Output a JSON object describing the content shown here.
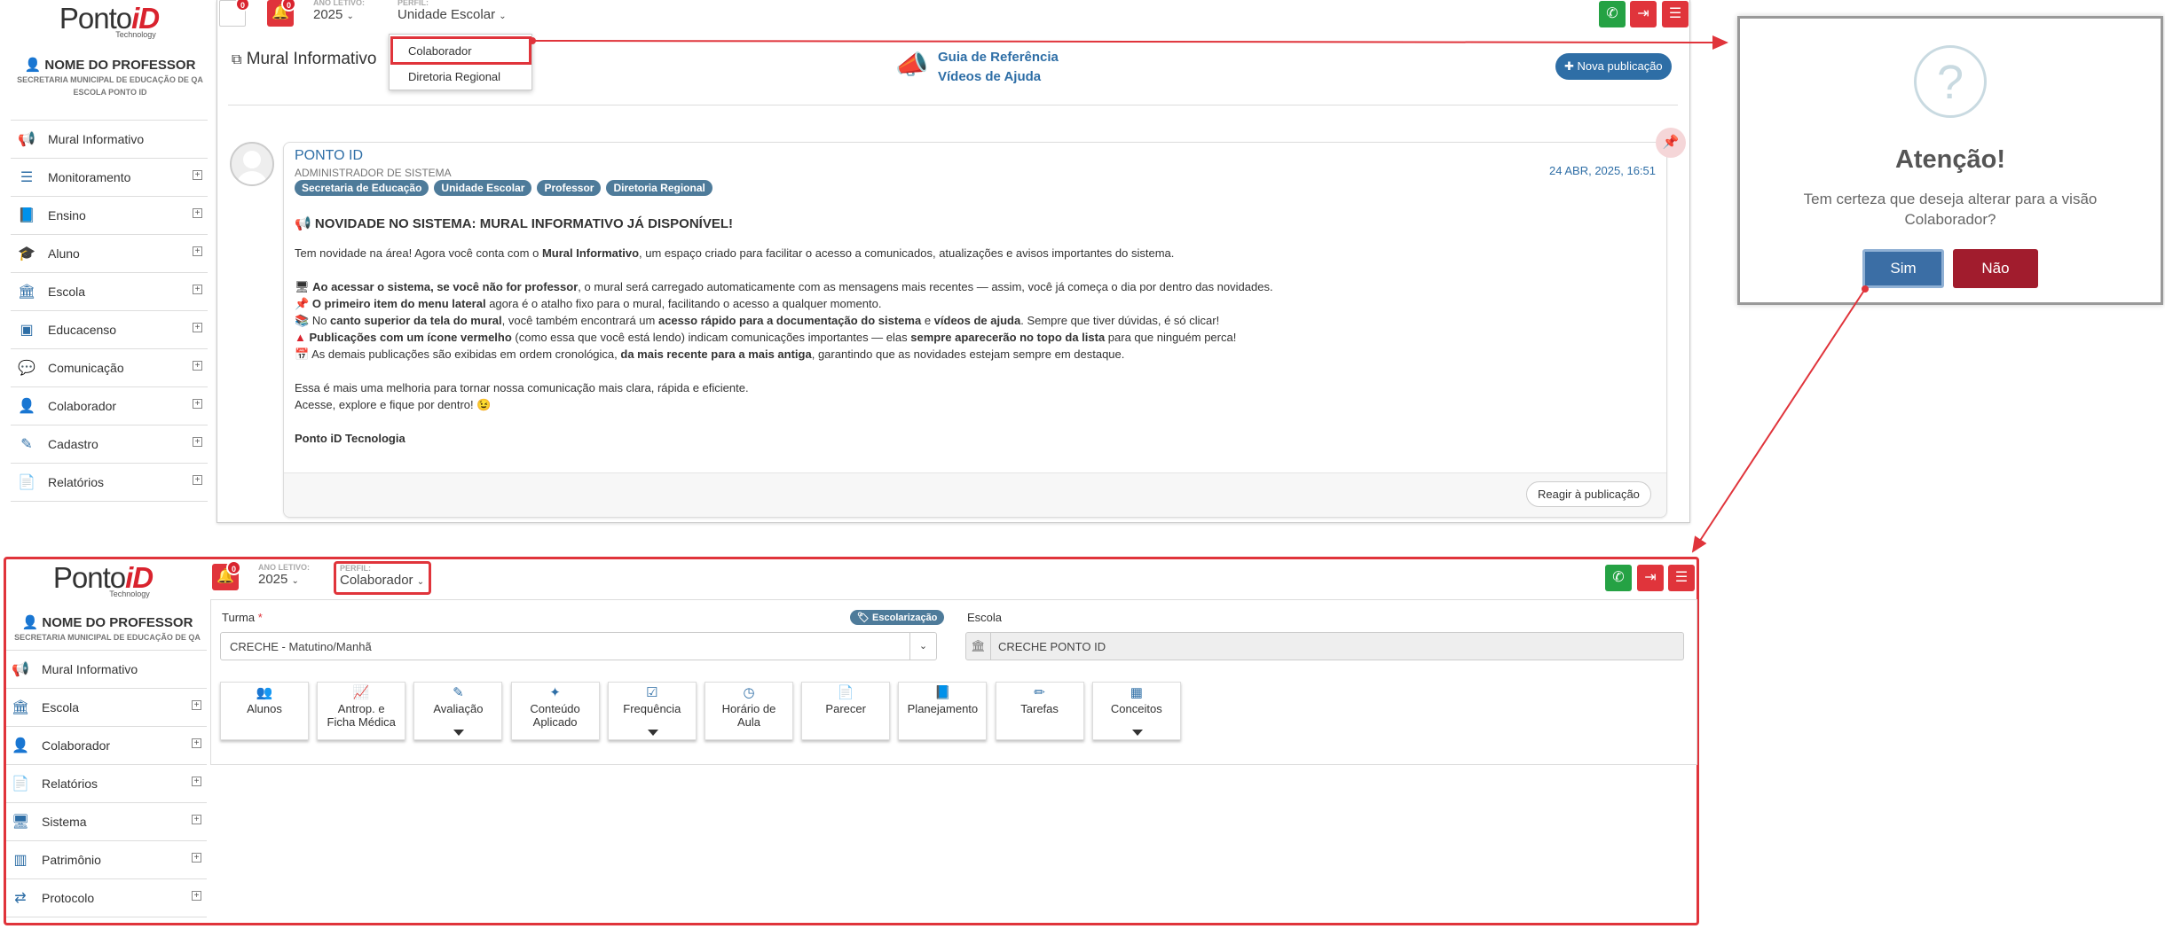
{
  "brand": {
    "logo_main": "Ponto",
    "logo_accent": "iD",
    "logo_sub": "Technology"
  },
  "top": {
    "notifications_badge": "0",
    "alert_badge": "0",
    "ano_letivo_label": "ANO LETIVO:",
    "ano_letivo_value": "2025",
    "perfil_label": "PERFIL:",
    "perfil_value": "Unidade Escolar",
    "dropdown": [
      "Colaborador",
      "Diretoria Regional"
    ],
    "profile": {
      "name": "NOME DO PROFESSOR",
      "secretaria": "SECRETARIA MUNICIPAL DE EDUCAÇÃO DE QA",
      "escola": "ESCOLA PONTO ID"
    },
    "menu": [
      {
        "label": "Mural Informativo",
        "icon": "megaphone-icon",
        "glyph": "📢",
        "expand": false
      },
      {
        "label": "Monitoramento",
        "icon": "sliders-icon",
        "glyph": "☰",
        "expand": true
      },
      {
        "label": "Ensino",
        "icon": "book-icon",
        "glyph": "📘",
        "expand": true
      },
      {
        "label": "Aluno",
        "icon": "graduation-cap-icon",
        "glyph": "🎓",
        "expand": true
      },
      {
        "label": "Escola",
        "icon": "bank-icon",
        "glyph": "🏛",
        "expand": true
      },
      {
        "label": "Educacenso",
        "icon": "id-card-icon",
        "glyph": "▣",
        "expand": true
      },
      {
        "label": "Comunicação",
        "icon": "chat-icon",
        "glyph": "💬",
        "expand": true
      },
      {
        "label": "Colaborador",
        "icon": "user-icon",
        "glyph": "👤",
        "expand": true
      },
      {
        "label": "Cadastro",
        "icon": "edit-icon",
        "glyph": "✎",
        "expand": true
      },
      {
        "label": "Relatórios",
        "icon": "report-icon",
        "glyph": "📄",
        "expand": true
      }
    ],
    "mural_title": "Mural Informativo",
    "guide_link": "Guia de Referência",
    "videos_link": "Vídeos de Ajuda",
    "new_post_button": "Nova publicação",
    "post": {
      "author": "PONTO ID",
      "role": "ADMINISTRADOR DE SISTEMA",
      "tags": [
        "Secretaria de Educação",
        "Unidade Escolar",
        "Professor",
        "Diretoria Regional"
      ],
      "date": "24 ABR, 2025, 16:51",
      "headline": "NOVIDADE NO SISTEMA: MURAL INFORMATIVO JÁ DISPONÍVEL!",
      "intro_a": "Tem novidade na área! Agora você conta com o ",
      "intro_b": "Mural Informativo",
      "intro_c": ", um espaço criado para facilitar o acesso a comunicados, atualizações e avisos importantes do sistema.",
      "l1_b": "Ao acessar o sistema, se você não for professor",
      "l1_c": ", o mural será carregado automaticamente com as mensagens mais recentes — assim, você já começa o dia por dentro das novidades.",
      "l2_b": "O primeiro item do menu lateral",
      "l2_c": " agora é o atalho fixo para o mural, facilitando o acesso a qualquer momento.",
      "l3_a": "No ",
      "l3_b": "canto superior da tela do mural",
      "l3_c": ", você também encontrará um ",
      "l3_d": "acesso rápido para a documentação do sistema",
      "l3_e": " e ",
      "l3_f": "vídeos de ajuda",
      "l3_g": ". Sempre que tiver dúvidas, é só clicar!",
      "l4_b": "Publicações com um ícone vermelho",
      "l4_c": " (como essa que você está lendo) indicam comunicações importantes — elas ",
      "l4_d": "sempre aparecerão no topo da lista",
      "l4_e": " para que ninguém perca!",
      "l5_a": "As demais publicações são exibidas em ordem cronológica, ",
      "l5_b": "da mais recente para a mais antiga",
      "l5_c": ", garantindo que as novidades estejam sempre em destaque.",
      "closing1": "Essa é mais uma melhoria para tornar nossa comunicação mais clara, rápida e eficiente.",
      "closing2": "Acesse, explore e fique por dentro! 😉",
      "signature": "Ponto iD Tecnologia",
      "react_button": "Reagir à publicação"
    }
  },
  "modal": {
    "title": "Atenção!",
    "message": "Tem certeza que deseja alterar para a visão Colaborador?",
    "yes": "Sim",
    "no": "Não"
  },
  "bottom": {
    "alert_badge": "0",
    "ano_letivo_label": "ANO LETIVO:",
    "ano_letivo_value": "2025",
    "perfil_label": "PERFIL:",
    "perfil_value": "Colaborador",
    "profile": {
      "name": "NOME DO PROFESSOR",
      "secretaria": "SECRETARIA MUNICIPAL DE EDUCAÇÃO DE QA"
    },
    "menu": [
      {
        "label": "Mural Informativo",
        "icon": "megaphone-icon",
        "glyph": "📢",
        "expand": false
      },
      {
        "label": "Escola",
        "icon": "bank-icon",
        "glyph": "🏛",
        "expand": true
      },
      {
        "label": "Colaborador",
        "icon": "user-icon",
        "glyph": "👤",
        "expand": true
      },
      {
        "label": "Relatórios",
        "icon": "report-icon",
        "glyph": "📄",
        "expand": true
      },
      {
        "label": "Sistema",
        "icon": "monitor-icon",
        "glyph": "🖥",
        "expand": true
      },
      {
        "label": "Patrimônio",
        "icon": "barcode-icon",
        "glyph": "▥",
        "expand": true
      },
      {
        "label": "Protocolo",
        "icon": "exchange-icon",
        "glyph": "⇄",
        "expand": true
      }
    ],
    "turma_label": "Turma",
    "turma_required": "*",
    "turma_value": "CRECHE - Matutino/Manhã",
    "escolarizacao_tag": "Escolarização",
    "escola_label": "Escola",
    "escola_value": "CRECHE PONTO ID",
    "tiles": [
      {
        "l1": "Alunos",
        "l2": "",
        "icon": "users-icon",
        "glyph": "👥",
        "caret": false
      },
      {
        "l1": "Antrop. e",
        "l2": "Ficha Médica",
        "icon": "chart-line-icon",
        "glyph": "📈",
        "caret": false
      },
      {
        "l1": "Avaliação",
        "l2": "",
        "icon": "edit-icon",
        "glyph": "✎",
        "caret": true
      },
      {
        "l1": "Conteúdo",
        "l2": "Aplicado",
        "icon": "magic-wand-icon",
        "glyph": "✦",
        "caret": false
      },
      {
        "l1": "Frequência",
        "l2": "",
        "icon": "check-square-icon",
        "glyph": "☑",
        "caret": true
      },
      {
        "l1": "Horário de",
        "l2": "Aula",
        "icon": "clock-icon",
        "glyph": "◷",
        "caret": false
      },
      {
        "l1": "Parecer",
        "l2": "",
        "icon": "document-icon",
        "glyph": "📄",
        "caret": false
      },
      {
        "l1": "Planejamento",
        "l2": "",
        "icon": "book-icon",
        "glyph": "📘",
        "caret": false
      },
      {
        "l1": "Tarefas",
        "l2": "",
        "icon": "pencil-icon",
        "glyph": "✏",
        "caret": false
      },
      {
        "l1": "Conceitos",
        "l2": "",
        "icon": "table-icon",
        "glyph": "▦",
        "caret": true
      }
    ]
  },
  "colors": {
    "accent_blue": "#2e6ea6",
    "danger_red": "#e0343b",
    "whatsapp_green": "#25a244",
    "modal_yes": "#3b6ea5",
    "modal_no": "#a11c2d"
  }
}
